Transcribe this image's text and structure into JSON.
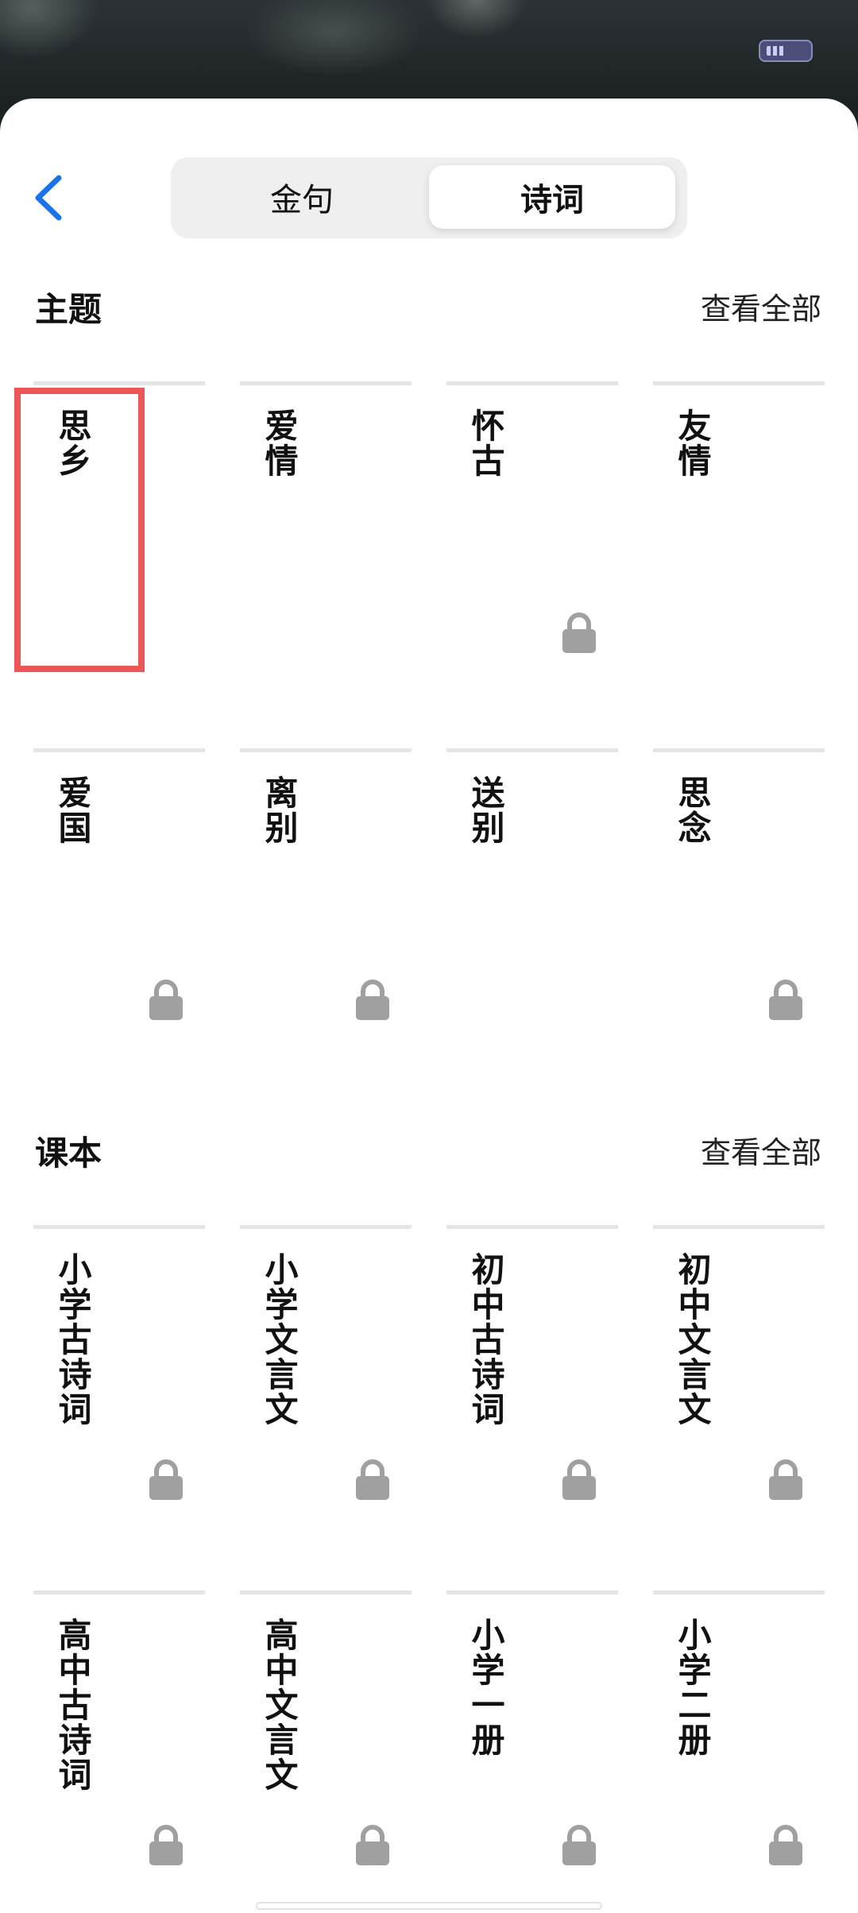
{
  "tabs": {
    "sentences": "金句",
    "poetry": "诗词",
    "active": "诗词"
  },
  "themes": {
    "title": "主题",
    "view_all": "查看全部",
    "items": [
      {
        "label": "思乡",
        "locked": false,
        "highlighted": true
      },
      {
        "label": "爱情",
        "locked": false
      },
      {
        "label": "怀古",
        "locked": true
      },
      {
        "label": "友情",
        "locked": false
      },
      {
        "label": "爱国",
        "locked": true
      },
      {
        "label": "离别",
        "locked": true
      },
      {
        "label": "送别",
        "locked": false
      },
      {
        "label": "思念",
        "locked": true
      }
    ]
  },
  "textbooks": {
    "title": "课本",
    "view_all": "查看全部",
    "items": [
      {
        "label": "小学古诗词",
        "locked": true
      },
      {
        "label": "小学文言文",
        "locked": true
      },
      {
        "label": "初中古诗词",
        "locked": true
      },
      {
        "label": "初中文言文",
        "locked": true
      },
      {
        "label": "高中古诗词",
        "locked": true
      },
      {
        "label": "高中文言文",
        "locked": true
      },
      {
        "label": "小学一册",
        "locked": true
      },
      {
        "label": "小学二册",
        "locked": true
      }
    ]
  },
  "colors": {
    "accent": "#1a73e8",
    "highlight": "#ec5656",
    "lock": "#a0a0a0"
  }
}
